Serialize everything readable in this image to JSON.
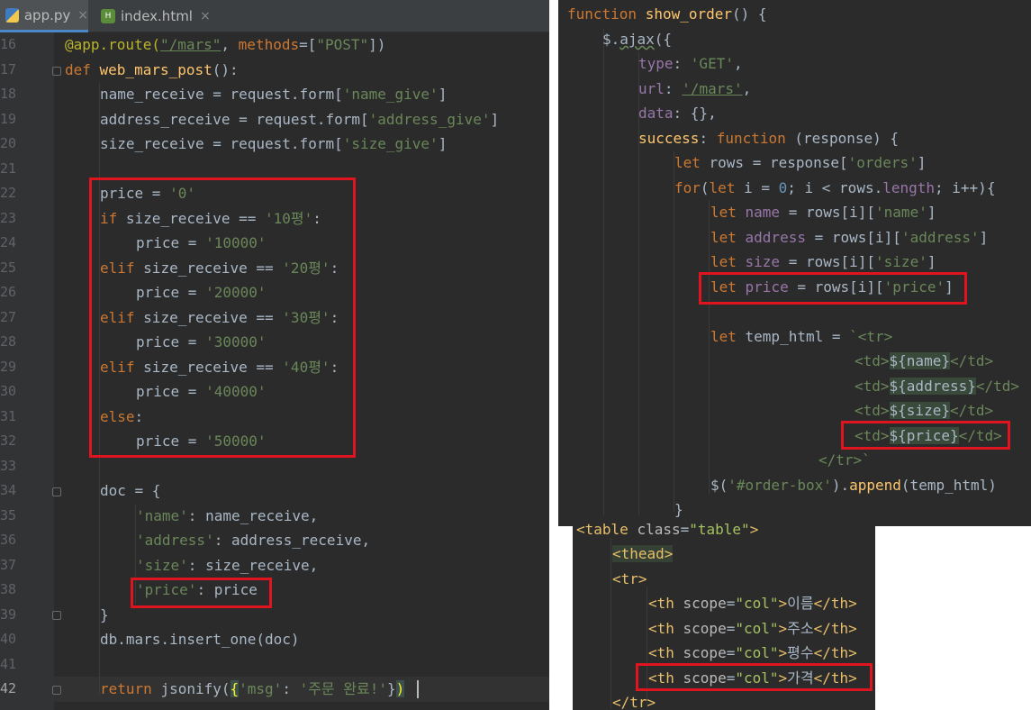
{
  "tabs": [
    {
      "label": "app.py",
      "close": "×"
    },
    {
      "label": "index.html",
      "close": "×"
    }
  ],
  "line_numbers": [
    "16",
    "17",
    "18",
    "19",
    "20",
    "21",
    "22",
    "23",
    "24",
    "25",
    "26",
    "27",
    "28",
    "29",
    "30",
    "31",
    "32",
    "33",
    "34",
    "35",
    "36",
    "37",
    "38",
    "39",
    "40",
    "41",
    "42"
  ],
  "python_code": {
    "l16": {
      "deco": "@app.route(",
      "url": "\"/mars\"",
      "sep": ", ",
      "kw": "methods",
      "rest": "=[",
      "str": "\"POST\"",
      "end": "])"
    },
    "l17": {
      "kw": "def ",
      "fn": "web_mars_post",
      "rest": "():"
    },
    "l18": {
      "a": "name_receive = request.form[",
      "s": "'name_give'",
      "b": "]"
    },
    "l19": {
      "a": "address_receive = request.form[",
      "s": "'address_give'",
      "b": "]"
    },
    "l20": {
      "a": "size_receive = request.form[",
      "s": "'size_give'",
      "b": "]"
    },
    "l22": {
      "a": "price = ",
      "s": "'0'"
    },
    "l23": {
      "kw": "if ",
      "a": "size_receive == ",
      "s": "'10평'",
      "b": ":"
    },
    "l24": {
      "a": "price = ",
      "s": "'10000'"
    },
    "l25": {
      "kw": "elif ",
      "a": "size_receive == ",
      "s": "'20평'",
      "b": ":"
    },
    "l26": {
      "a": "price = ",
      "s": "'20000'"
    },
    "l27": {
      "kw": "elif ",
      "a": "size_receive == ",
      "s": "'30평'",
      "b": ":"
    },
    "l28": {
      "a": "price = ",
      "s": "'30000'"
    },
    "l29": {
      "kw": "elif ",
      "a": "size_receive == ",
      "s": "'40평'",
      "b": ":"
    },
    "l30": {
      "a": "price = ",
      "s": "'40000'"
    },
    "l31": {
      "kw": "else",
      "b": ":"
    },
    "l32": {
      "a": "price = ",
      "s": "'50000'"
    },
    "l34": {
      "a": "doc = {"
    },
    "l35": {
      "s": "'name'",
      "a": ": name_receive,"
    },
    "l36": {
      "s": "'address'",
      "a": ": address_receive,"
    },
    "l37": {
      "s": "'size'",
      "a": ": size_receive,"
    },
    "l38": {
      "s": "'price'",
      "a": ": price"
    },
    "l39": {
      "a": "}"
    },
    "l40": {
      "a": "db.mars.insert_one(doc)"
    },
    "l42": {
      "kw": "return ",
      "a": "jsonify(",
      "b": "{",
      "s1": "'msg'",
      "c": ": ",
      "s2": "'주문 완료!'",
      "d": "}",
      "e": ")"
    }
  },
  "js_code": {
    "j1": {
      "kw": "function ",
      "fn": "show_order",
      "rest": "() {"
    },
    "j2": {
      "a": "$.",
      "b": "ajax",
      "c": "({"
    },
    "j3": {
      "p": "type",
      "a": ": ",
      "s": "'GET'",
      "b": ","
    },
    "j4": {
      "p": "url",
      "a": ": ",
      "s": "'/mars'",
      "b": ","
    },
    "j5": {
      "p": "data",
      "a": ": {},"
    },
    "j6": {
      "p": "success",
      "a": ": ",
      "kw": "function ",
      "b": "(response) {"
    },
    "j7": {
      "kw": "let ",
      "a": "rows = response[",
      "s": "'orders'",
      "b": "]"
    },
    "j8": {
      "kw": "for",
      "a": "(",
      "kw2": "let ",
      "b": "i = ",
      "n": "0",
      "c": "; i < rows.",
      "p": "length",
      "d": "; i++){"
    },
    "j9": {
      "kw": "let ",
      "v": "name",
      "a": " = rows[i][",
      "s": "'name'",
      "b": "]"
    },
    "j10": {
      "kw": "let ",
      "v": "address",
      "a": " = rows[i][",
      "s": "'address'",
      "b": "]"
    },
    "j11": {
      "kw": "let ",
      "v": "size",
      "a": " = rows[i][",
      "s": "'size'",
      "b": "]"
    },
    "j12": {
      "kw": "let ",
      "v": "price",
      "a": " = rows[i][",
      "s": "'price'",
      "b": "]"
    },
    "j14": {
      "kw": "let ",
      "a": "temp_html = ",
      "t": "`<tr>"
    },
    "j15": {
      "t1": "<td>",
      "i": "${name}",
      "t2": "</td>"
    },
    "j16": {
      "t1": "<td>",
      "i": "${address}",
      "t2": "</td>"
    },
    "j17": {
      "t1": "<td>",
      "i": "${size}",
      "t2": "</td>"
    },
    "j18": {
      "t1": "<td>",
      "i": "${price}",
      "t2": "</td>"
    },
    "j19": {
      "t": "</tr>`"
    },
    "j20": {
      "a": "$(",
      "s": "'#order-box'",
      "b": ").",
      "f": "append",
      "c": "(temp_html)"
    },
    "j21": {
      "a": "}"
    }
  },
  "html_code": {
    "h1": {
      "t1": "<table ",
      "attr": "class",
      "eq": "=",
      "val": "\"table\"",
      "t2": ">"
    },
    "h2": {
      "t": "<thead>"
    },
    "h3": {
      "t": "<tr>"
    },
    "h4": {
      "t1": "<th ",
      "attr": "scope",
      "eq": "=",
      "val": "\"col\"",
      "t2": ">",
      "text": "이름",
      "t3": "</th>"
    },
    "h5": {
      "t1": "<th ",
      "attr": "scope",
      "eq": "=",
      "val": "\"col\"",
      "t2": ">",
      "text": "주소",
      "t3": "</th>"
    },
    "h6": {
      "t1": "<th ",
      "attr": "scope",
      "eq": "=",
      "val": "\"col\"",
      "t2": ">",
      "text": "평수",
      "t3": "</th>"
    },
    "h7": {
      "t1": "<th ",
      "attr": "scope",
      "eq": "=",
      "val": "\"col\"",
      "t2": ">",
      "text": "가격",
      "t3": "</th>"
    },
    "h8": {
      "t": "</tr>"
    }
  },
  "colors": {
    "editor_bg": "#2b2b2b",
    "highlight_box": "#e0141e",
    "keyword": "#cc7832",
    "string": "#6a8759",
    "function": "#ffc66d"
  }
}
